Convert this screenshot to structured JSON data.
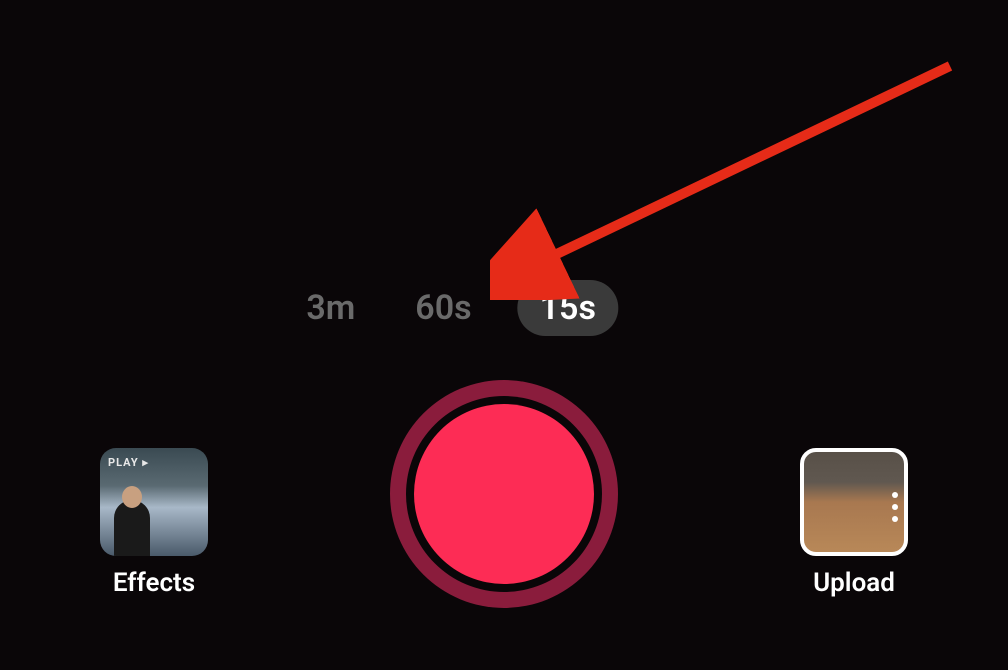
{
  "duration_options": {
    "option1": "3m",
    "option2": "60s",
    "option3": "15s",
    "selected_index": 2
  },
  "effects": {
    "label": "Effects",
    "badge": "PLAY ▸"
  },
  "upload": {
    "label": "Upload"
  },
  "colors": {
    "accent": "#fd2c55",
    "ring": "#8a1c3c",
    "background": "#0a0608",
    "annotation": "#e62b18"
  }
}
